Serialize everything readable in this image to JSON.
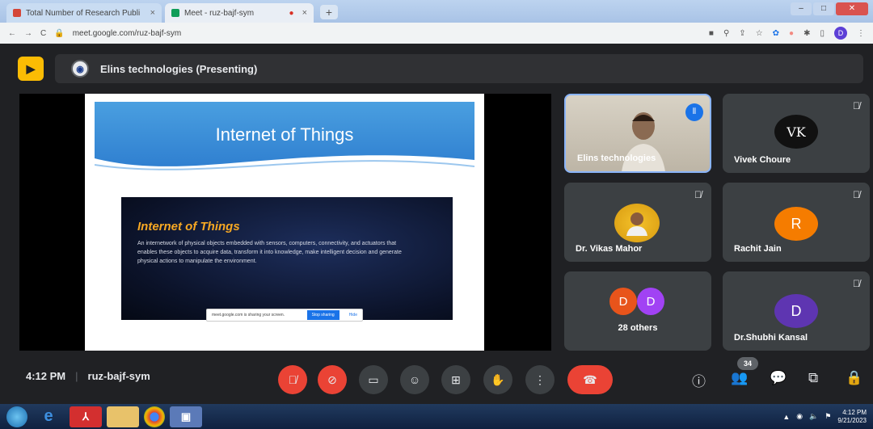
{
  "browser": {
    "tabs": [
      {
        "label": "Total Number of Research Publi",
        "close": "×"
      },
      {
        "label": "Meet - ruz-bajf-sym",
        "close": "×"
      }
    ],
    "new_tab": "+",
    "url": "meet.google.com/ruz-bajf-sym",
    "profile_initial": "D"
  },
  "meet": {
    "presenter_label": "Elins technologies (Presenting)",
    "slide": {
      "title": "Internet of Things",
      "box_title": "Internet of Things",
      "box_body": "An internetwork of physical objects embedded with sensors, computers, connectivity, and actuators that enables these objects to acquire data, transform it into knowledge, make intelligent decision and generate physical actions to manipulate the environment.",
      "share_msg": "meet.google.com is sharing your screen.",
      "stop_label": "Stop sharing",
      "hide_label": "Hide"
    },
    "participants": [
      {
        "name": "Elins technologies",
        "type": "video"
      },
      {
        "name": "Vivek Choure",
        "initials": "VK",
        "color": "#111111"
      },
      {
        "name": "Dr. Vikas Mahor",
        "type": "photo"
      },
      {
        "name": "Rachit Jain",
        "initials": "R",
        "color": "#f57c00"
      },
      {
        "name": "28 others",
        "initials_a": "D",
        "initials_b": "D",
        "color_a": "#e8541b",
        "color_b": "#a142f4"
      },
      {
        "name": "Dr.Shubhi Kansal",
        "initials": "D",
        "color": "#5e35b1"
      }
    ],
    "time": "4:12 PM",
    "meeting_code": "ruz-bajf-sym",
    "participant_count": "34"
  },
  "taskbar": {
    "time": "4:12 PM",
    "date": "9/21/2023"
  }
}
